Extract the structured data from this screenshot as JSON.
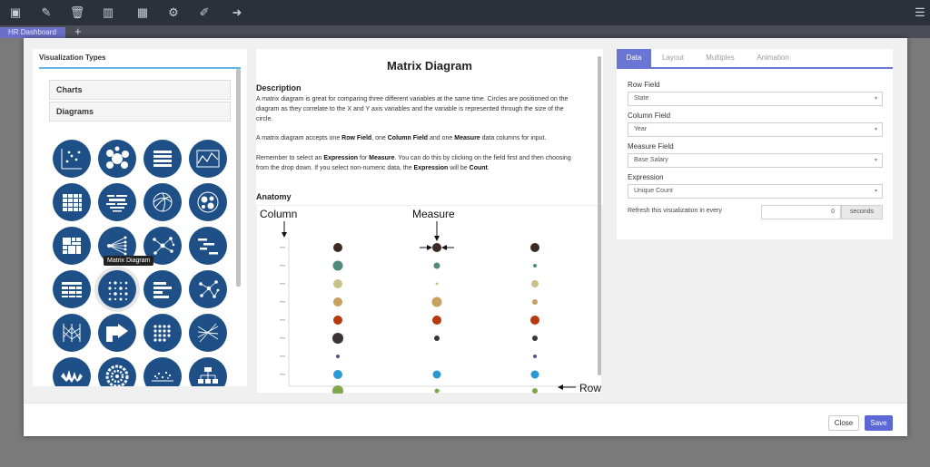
{
  "toolbar": {
    "icons": [
      "save-icon",
      "edit-icon",
      "trash-icon",
      "bar-chart-icon",
      "layout-icon",
      "gear-icon",
      "brush-icon",
      "logout-icon",
      "hamburger-menu-icon"
    ],
    "glyphs": [
      "▣",
      "✎",
      "🗑",
      "▥",
      "▦",
      "⚙",
      "✐",
      "➜",
      "☰"
    ]
  },
  "tabs_bar": {
    "dashboard_tab": "HR Dashboard",
    "add_tab": "+"
  },
  "left_panel": {
    "title": "Visualization Types",
    "sections": [
      "Charts",
      "Diagrams"
    ],
    "hover_tooltip": "Matrix Diagram"
  },
  "description": {
    "title": "Matrix Diagram",
    "heading": "Description",
    "p1": "A matrix diagram is great for comparing three different variables at the same time. Circles are positioned on the diagram as they correlate to the X and Y axis variables and the variable is represented through the size of the circle.",
    "p2_a": "A matrix diagram accepts one ",
    "p2_b": "Row Field",
    "p2_c": ", one ",
    "p2_d": "Column Field",
    "p2_e": " and one ",
    "p2_f": "Measure",
    "p2_g": " data columns for input.",
    "p3_a": "Remember to select an ",
    "p3_b": "Expression",
    "p3_c": " for ",
    "p3_d": "Measure",
    "p3_e": ". You can do this by clicking on the field first and then choosing from the drop down. If you select non-numeric data, the ",
    "p3_f": "Expression",
    "p3_g": " will be ",
    "p3_h": "Count",
    "p3_i": ".",
    "anatomy_heading": "Anatomy",
    "anatomy_labels": {
      "column": "Column",
      "measure": "Measure",
      "row": "Row"
    }
  },
  "settings": {
    "tabs": [
      "Data",
      "Layout",
      "Multiples",
      "Animation"
    ],
    "active_tab": "Data",
    "row_field": {
      "label": "Row Field",
      "value": "State"
    },
    "column_field": {
      "label": "Column Field",
      "value": "Year"
    },
    "measure_field": {
      "label": "Measure Field",
      "value": "Base Salary"
    },
    "expression": {
      "label": "Expression",
      "value": "Unique Count"
    },
    "refresh": {
      "label": "Refresh this visualization in every",
      "value": "0",
      "unit": "seconds"
    }
  },
  "footer": {
    "close": "Close",
    "save": "Save"
  },
  "colors": {
    "accent": "#6a76d6",
    "icon_bg": "#1e4f86",
    "top_bar": "#2c3038"
  }
}
